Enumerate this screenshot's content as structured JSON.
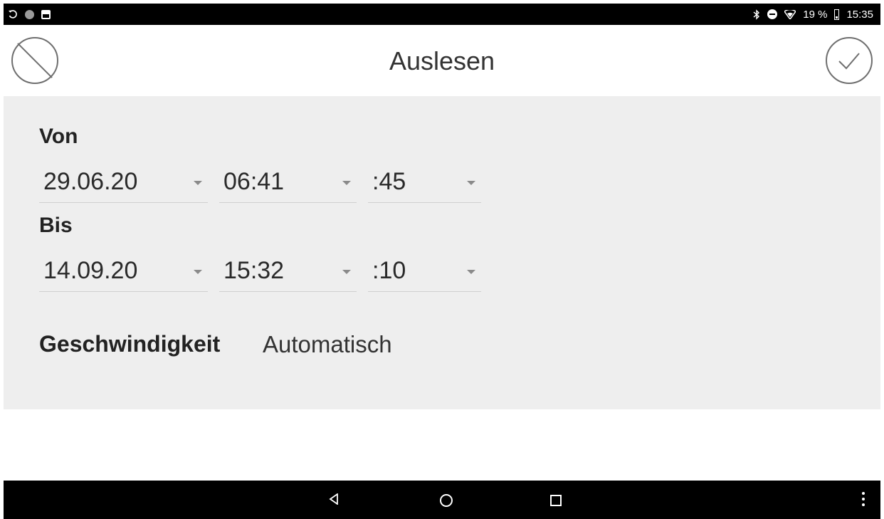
{
  "status_bar": {
    "icons_left": [
      "rotate-icon",
      "circle-icon",
      "image-icon"
    ],
    "icons_right": [
      "bluetooth-icon",
      "do-not-disturb-icon",
      "wifi-icon",
      "battery-icon"
    ],
    "battery": "19 %",
    "time": "15:35"
  },
  "header": {
    "title": "Auslesen",
    "cancel_icon": "cancel-icon",
    "confirm_icon": "check-icon"
  },
  "form": {
    "from": {
      "label": "Von",
      "date": "29.06.20",
      "time": "06:41",
      "seconds": ":45"
    },
    "to": {
      "label": "Bis",
      "date": "14.09.20",
      "time": "15:32",
      "seconds": ":10"
    },
    "speed": {
      "label": "Geschwindigkeit",
      "value": "Automatisch"
    }
  },
  "nav_bar": {
    "icons": [
      "back-icon",
      "home-icon",
      "recents-icon",
      "overflow-menu-icon"
    ]
  }
}
